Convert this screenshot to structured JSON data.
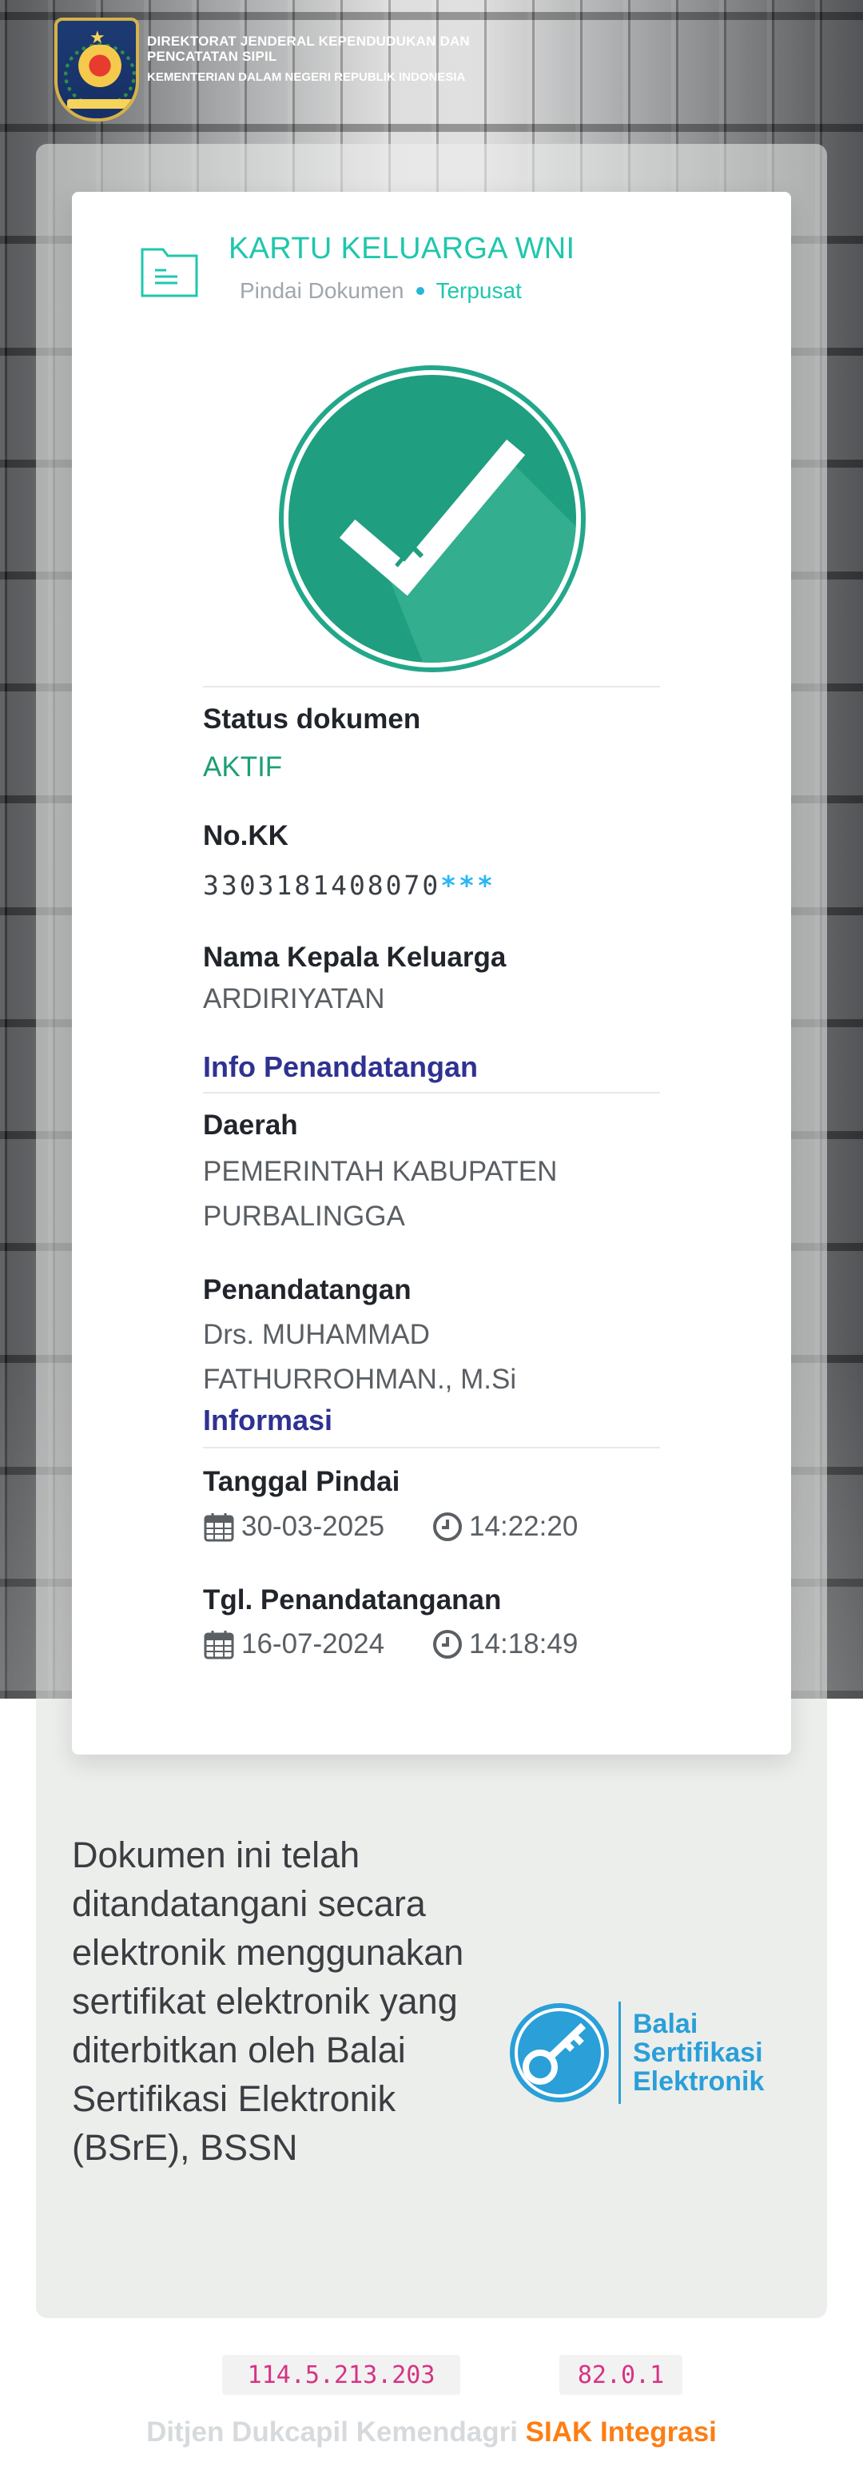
{
  "header": {
    "org_line1": "DIREKTORAT JENDERAL KEPENDUDUKAN DAN PENCATATAN SIPIL",
    "org_line2": "KEMENTERIAN DALAM NEGERI REPUBLIK INDONESIA"
  },
  "card": {
    "title": "KARTU KELUARGA WNI",
    "subtitle_scan": "Pindai Dokumen",
    "subtitle_central": "Terpusat",
    "icon": "document-icon",
    "badge_icon": "check-circle-icon",
    "fields": {
      "status_label": "Status dokumen",
      "status_value": "AKTIF",
      "kk_label": "No.KK",
      "kk_value": "3303181408070",
      "kk_mask": "***",
      "head_label": "Nama Kepala Keluarga",
      "head_value": "ARDIRIYATAN"
    },
    "signing_info": {
      "section_title": "Info Penandatangan",
      "region_label": "Daerah",
      "region_value": "PEMERINTAH KABUPATEN PURBALINGGA",
      "signer_label": "Penandatangan",
      "signer_value": "Drs. MUHAMMAD FATHURROHMAN., M.Si"
    },
    "information": {
      "section_title": "Informasi",
      "scan_label": "Tanggal Pindai",
      "scan_date": "30-03-2025",
      "scan_time": "14:22:20",
      "sign_label": "Tgl. Penandatanganan",
      "sign_date": "16-07-2024",
      "sign_time": "14:18:49"
    }
  },
  "statement": {
    "text": "Dokumen ini telah ditandatangani secara elektronik menggunakan sertifikat elektronik yang diterbitkan oleh Balai Sertifikasi Elektronik (BSrE), BSSN",
    "logo_line1": "Balai",
    "logo_line2": "Sertifikasi",
    "logo_line3": "Elektronik"
  },
  "footer": {
    "ip": "114.5.213.203",
    "version": "82.0.1",
    "org": "Ditjen Dukcapil Kemendagri",
    "product": "SIAK Integrasi"
  },
  "colors": {
    "accent": "#1fc7ad",
    "status_green": "#1f9e77",
    "section_blue": "#2f3192",
    "mask_blue": "#29b6f6",
    "footer_orange": "#fd7e14",
    "bsre_blue": "#2a9fd8"
  }
}
